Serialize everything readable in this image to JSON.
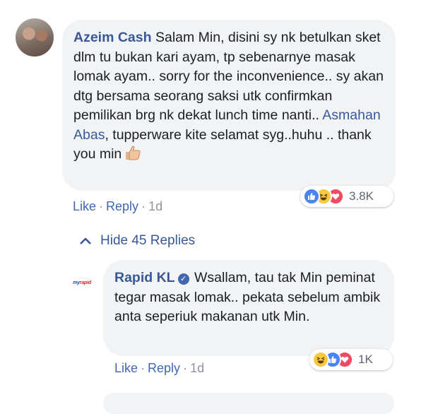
{
  "comment": {
    "author": "Azeim Cash",
    "text_before_mention": " Salam Min, disini sy nk betulkan sket dlm tu bukan kari ayam, tp sebenarnye masak lomak ayam.. sorry for the inconvenience.. sy akan dtg bersama seorang saksi utk confirmkan pemilikan brg nk dekat lunch time nanti.. ",
    "mention": "Asmahan Abas",
    "text_after_mention": ", tupperware kite selamat syg..huhu .. thank you min",
    "emoji": "thumbs-up-emoji",
    "reactions": {
      "icons": [
        "like",
        "haha",
        "love"
      ],
      "count": "3.8K"
    },
    "actions": {
      "like": "Like",
      "reply": "Reply",
      "time": "1d"
    }
  },
  "hide_replies": {
    "label": "Hide 45 Replies",
    "icon": "chevron-up-icon"
  },
  "reply": {
    "author": "Rapid KL",
    "verified": true,
    "text": " Wsallam, tau tak Min peminat tegar masak lomak.. pekata sebelum ambik anta seperiuk makanan utk Min.",
    "reactions": {
      "icons": [
        "haha",
        "like",
        "love"
      ],
      "count": "1K"
    },
    "actions": {
      "like": "Like",
      "reply": "Reply",
      "time": "1d"
    }
  },
  "colors": {
    "link_blue": "#385898",
    "action_blue": "#4267b2",
    "bubble_bg": "#f2f3f5",
    "meta_gray": "#90949c"
  }
}
